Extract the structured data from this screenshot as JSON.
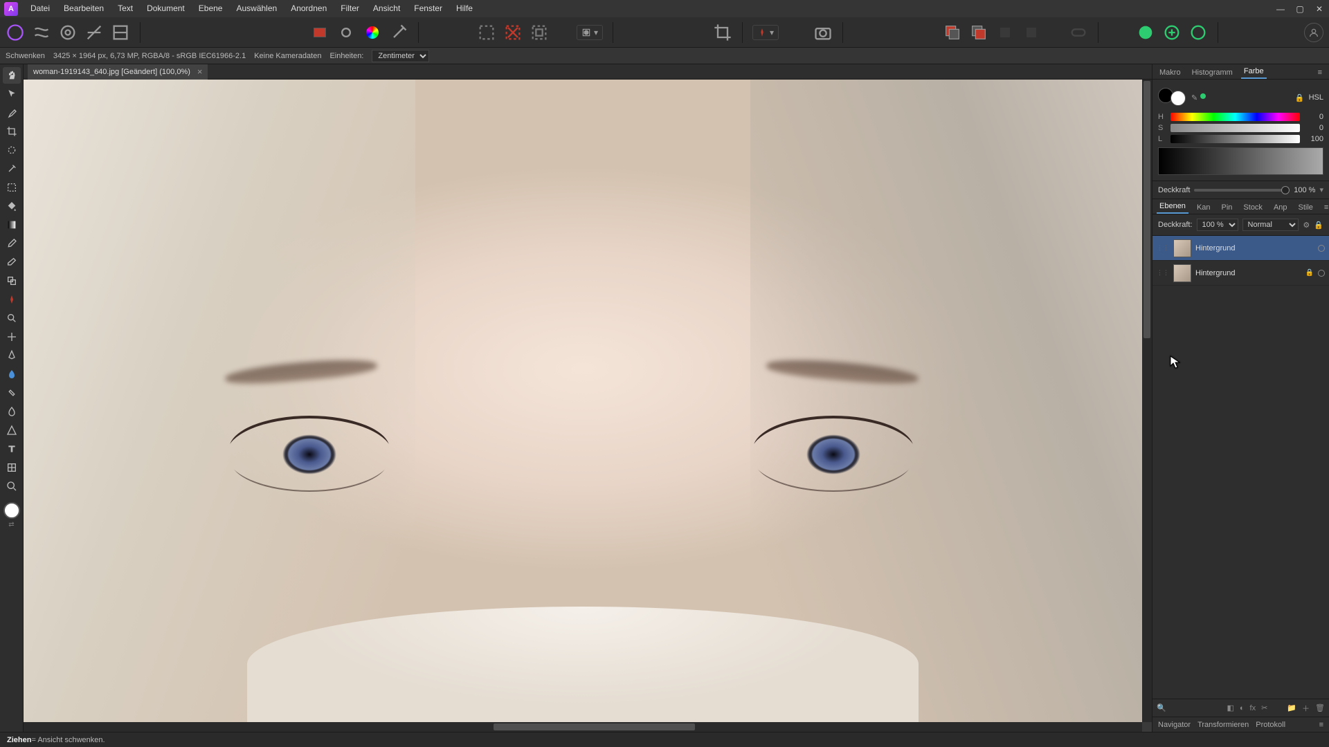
{
  "menu": [
    "Datei",
    "Bearbeiten",
    "Text",
    "Dokument",
    "Ebene",
    "Auswählen",
    "Anordnen",
    "Filter",
    "Ansicht",
    "Fenster",
    "Hilfe"
  ],
  "context": {
    "tool": "Schwenken",
    "dims": "3425 × 1964 px, 6,73 MP, RGBA/8 - sRGB IEC61966-2.1",
    "camera": "Keine Kameradaten",
    "units_label": "Einheiten:",
    "units_value": "Zentimeter"
  },
  "doc_tab": "woman-1919143_640.jpg [Geändert] (100,0%)",
  "panels_top_tabs": [
    "Makro",
    "Histogramm",
    "Farbe"
  ],
  "panels_top_active": "Farbe",
  "color_mode": "HSL",
  "hsl": {
    "h": "0",
    "s": "0",
    "l": "100"
  },
  "opacity_label": "Deckkraft",
  "opacity_value": "100 %",
  "layers_tabs": [
    "Ebenen",
    "Kan",
    "Pin",
    "Stock",
    "Anp",
    "Stile"
  ],
  "layers_tabs_active": "Ebenen",
  "layers_header": {
    "opacity_label": "Deckkraft:",
    "opacity_value": "100 %",
    "blend": "Normal"
  },
  "layers": [
    {
      "name": "Hintergrund",
      "selected": true,
      "locked": false
    },
    {
      "name": "Hintergrund",
      "selected": false,
      "locked": true
    }
  ],
  "bottom_tabs": [
    "Navigator",
    "Transformieren",
    "Protokoll"
  ],
  "status": {
    "action": "Ziehen",
    "desc": " = Ansicht schwenken."
  }
}
